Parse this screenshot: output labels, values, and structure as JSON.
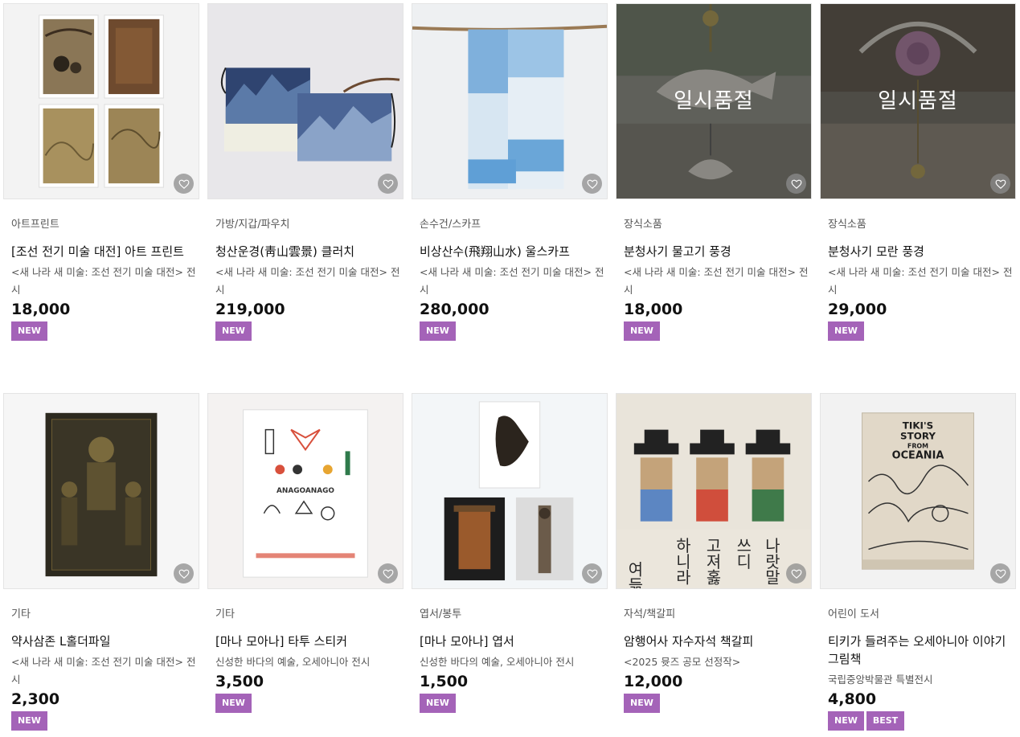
{
  "colors": {
    "badge": "#a463b8",
    "soldout_overlay": "rgba(40,40,40,0.45)",
    "wish_button": "#8c8c8c"
  },
  "products": [
    {
      "category": "아트프린트",
      "name": "[조선 전기 미술 대전] 아트 프린트",
      "description": "<새 나라 새 미술: 조선 전기 미술 대전> 전시",
      "price": "18,000",
      "badges": [
        "NEW"
      ],
      "sold_out_label": ""
    },
    {
      "category": "가방/지갑/파우치",
      "name": "청산운경(靑山雲景) 클러치",
      "description": "<새 나라 새 미술: 조선 전기 미술 대전> 전시",
      "price": "219,000",
      "badges": [
        "NEW"
      ],
      "sold_out_label": ""
    },
    {
      "category": "손수건/스카프",
      "name": "비상산수(飛翔山水) 울스카프",
      "description": "<새 나라 새 미술: 조선 전기 미술 대전> 전시",
      "price": "280,000",
      "badges": [
        "NEW"
      ],
      "sold_out_label": ""
    },
    {
      "category": "장식소품",
      "name": "분청사기 물고기 풍경",
      "description": "<새 나라 새 미술: 조선 전기 미술 대전> 전시",
      "price": "18,000",
      "badges": [
        "NEW"
      ],
      "sold_out_label": "일시품절"
    },
    {
      "category": "장식소품",
      "name": "분청사기 모란 풍경",
      "description": "<새 나라 새 미술: 조선 전기 미술 대전> 전시",
      "price": "29,000",
      "badges": [
        "NEW"
      ],
      "sold_out_label": "일시품절"
    },
    {
      "category": "기타",
      "name": "약사삼존 L홀더파일",
      "description": "<새 나라 새 미술: 조선 전기 미술 대전> 전시",
      "price": "2,300",
      "badges": [
        "NEW"
      ],
      "sold_out_label": ""
    },
    {
      "category": "기타",
      "name": "[마나 모아나] 타투 스티커",
      "description": "신성한 바다의 예술, 오세아니아 전시",
      "price": "3,500",
      "badges": [
        "NEW"
      ],
      "sold_out_label": ""
    },
    {
      "category": "엽서/봉투",
      "name": "[마나 모아나] 엽서",
      "description": "신성한 바다의 예술, 오세아니아 전시",
      "price": "1,500",
      "badges": [
        "NEW"
      ],
      "sold_out_label": ""
    },
    {
      "category": "자석/책갈피",
      "name": "암행어사 자수자석 책갈피",
      "description": "<2025 뮷즈 공모 선정작>",
      "price": "12,000",
      "badges": [
        "NEW"
      ],
      "sold_out_label": ""
    },
    {
      "category": "어린이 도서",
      "name": "티키가 들려주는 오세아니아 이야기 그림책",
      "description": "국립중앙박물관 특별전시",
      "price": "4,800",
      "badges": [
        "NEW",
        "BEST"
      ],
      "sold_out_label": ""
    }
  ],
  "artwork_text": {
    "sticker_sheet_title": "ANAGOANAGO",
    "book_title_1": "TIKI'S",
    "book_title_2": "STORY",
    "book_title_3": "FROM",
    "book_title_4": "OCEANIA",
    "bookmark_chars_1": "여듦字",
    "bookmark_chars_2": "하니라",
    "bookmark_chars_3": "고져홇",
    "bookmark_chars_4": "쓰디",
    "bookmark_chars_5": "나랏말"
  },
  "icons": {
    "wish": "heart-icon"
  }
}
